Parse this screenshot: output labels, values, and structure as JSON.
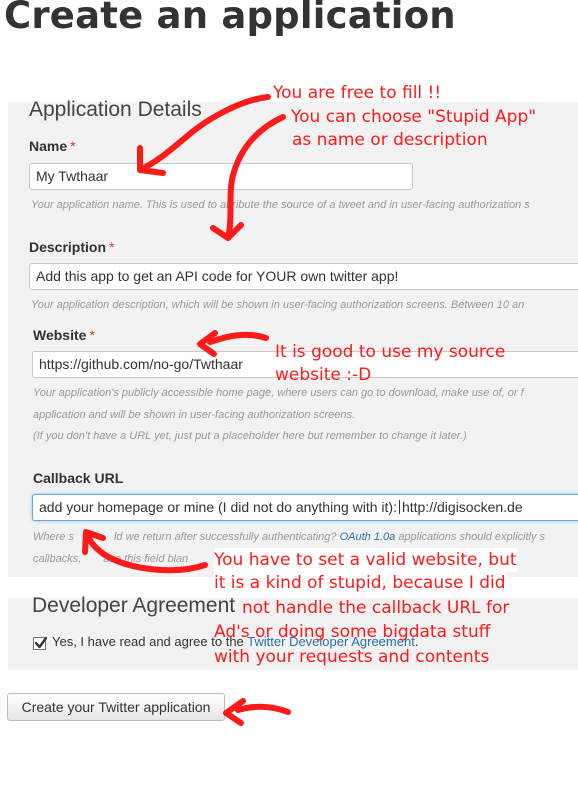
{
  "page": {
    "title": "Create an application"
  },
  "details": {
    "heading": "Application Details",
    "name": {
      "label": "Name",
      "required_mark": "*",
      "value": "My Twthaar",
      "help": "Your application name. This is used to attribute the source of a tweet and in user-facing authorization s"
    },
    "description": {
      "label": "Description",
      "required_mark": "*",
      "value": "Add this app to get an API code for YOUR own twitter app!",
      "help": "Your application description, which will be shown in user-facing authorization screens. Between 10 an"
    },
    "website": {
      "label": "Website",
      "required_mark": "*",
      "value": "https://github.com/no-go/Twthaar",
      "help_line1": "Your application's publicly accessible home page, where users can go to download, make use of, or f",
      "help_line2": "application and will be shown in user-facing authorization screens.",
      "help_line3": "(If you don't have a URL yet, just put a placeholder here but remember to change it later.)"
    },
    "callback": {
      "label": "Callback URL",
      "value_before_caret": "add your homepage or mine (I did not do anything with it):",
      "value_after_caret": "http://digisocken.de",
      "help_line1_prefix": "Where s",
      "help_line1_mid": "ld we return after successfully authenticating?",
      "help_link": "OAuth 1.0a",
      "help_line1_suffix": "applications should explicitly s",
      "help_line2": "callbacks,",
      "help_line2_rest": "ave this field blan"
    }
  },
  "agreement": {
    "heading": "Developer Agreement",
    "checked": true,
    "text_prefix": "Yes, I have read and agree to the",
    "link": "Twitter Developer Agreement",
    "text_suffix": "."
  },
  "submit": {
    "label": "Create your Twitter application"
  },
  "annotations": {
    "note1": "You are free to fill !!",
    "note2_line1": "You can choose \"Stupid App\"",
    "note2_line2": "as name or description",
    "note3_line1": "It is good to use my source",
    "note3_line2": "website :-D",
    "note4_line1": "You have to set a valid website, but",
    "note4_line2": "it is a kind of stupid, because I did",
    "note4_line3": "not handle the callback URL for",
    "note4_line4": "Ad's or doing some bigdata stuff",
    "note4_line5": "with your requests and contents"
  },
  "colors": {
    "annotation": "#ff1a1a",
    "panel_bg": "#f2f2f2",
    "required": "#d9342b",
    "link": "#2a6fb0"
  }
}
